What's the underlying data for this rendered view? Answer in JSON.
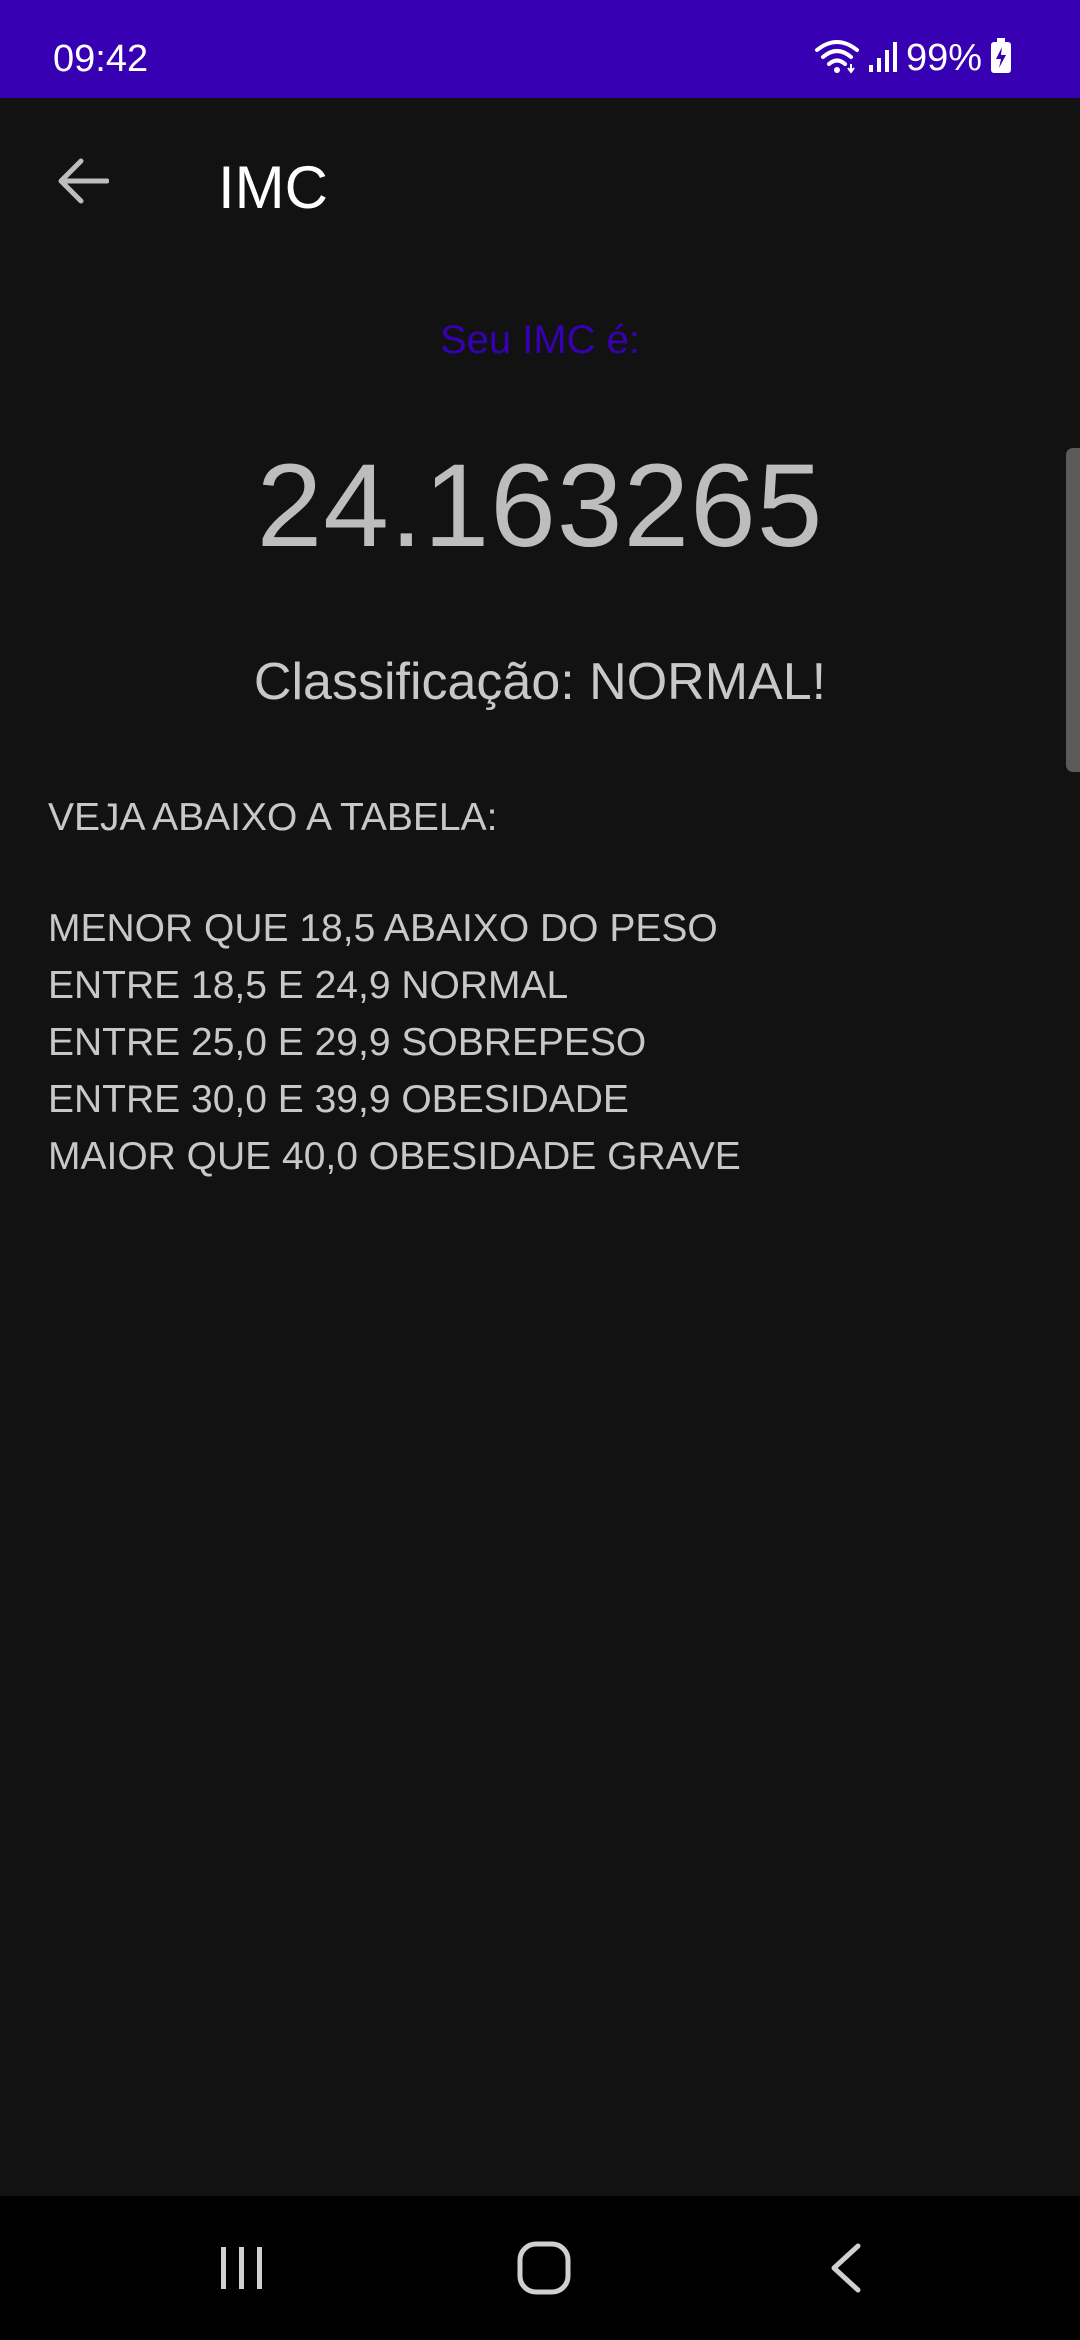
{
  "status_bar": {
    "time": "09:42",
    "battery_text": "99%",
    "icons": [
      "wifi-icon",
      "signal-icon",
      "battery-charging-icon"
    ]
  },
  "app_bar": {
    "title": "IMC",
    "back_icon": "arrow-back-icon"
  },
  "result": {
    "label": "Seu IMC é:",
    "value": "24.163265",
    "classification": "Classificação: NORMAL!"
  },
  "table": {
    "heading": "VEJA ABAIXO A TABELA:",
    "rows": [
      "MENOR QUE 18,5 ABAIXO DO PESO",
      "ENTRE 18,5 E 24,9 NORMAL",
      "ENTRE 25,0 E 29,9 SOBREPESO",
      "ENTRE 30,0 E 39,9 OBESIDADE",
      "MAIOR QUE 40,0 OBESIDADE GRAVE"
    ]
  },
  "nav_bar": {
    "buttons": [
      "recents-icon",
      "home-icon",
      "back-icon"
    ]
  },
  "colors": {
    "status_bar": "#3700B3",
    "accent": "#3700B3",
    "background": "#121212",
    "nav_bar": "#000000"
  }
}
